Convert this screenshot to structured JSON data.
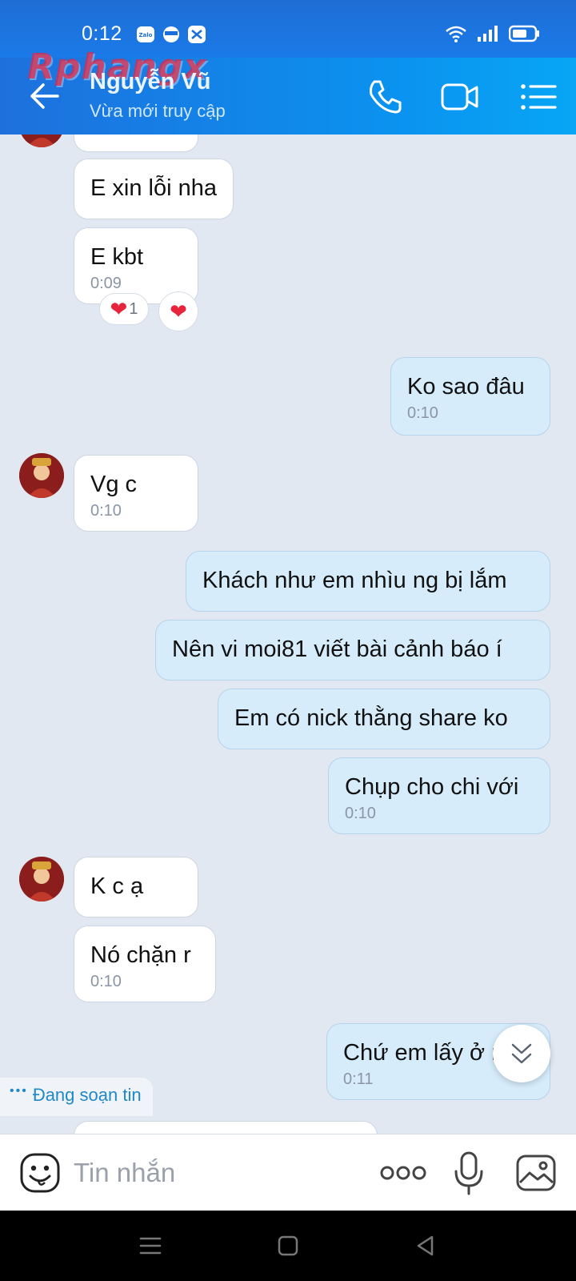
{
  "status_bar": {
    "time": "0:12"
  },
  "header": {
    "watermark": "Rphangx",
    "contact_name": "Nguyễn Vũ",
    "contact_status": "Vừa mới truy cập"
  },
  "messages": [
    {
      "id": "m0",
      "side": "in",
      "text": ""
    },
    {
      "id": "m1",
      "side": "in",
      "text": "E xin lỗi nha"
    },
    {
      "id": "m2",
      "side": "in",
      "text": "E kbt",
      "time": "0:09",
      "reaction_count": "1"
    },
    {
      "id": "m3",
      "side": "out",
      "text": "Ko sao đâu",
      "time": "0:10"
    },
    {
      "id": "m4",
      "side": "in",
      "text": "Vg c",
      "time": "0:10"
    },
    {
      "id": "m5",
      "side": "out",
      "text": "Khách như em nhìu ng bị lắm"
    },
    {
      "id": "m6",
      "side": "out",
      "text": "Nên vi moi81 viết bài cảnh báo í"
    },
    {
      "id": "m7",
      "side": "out",
      "text": "Em có nick thằng share ko"
    },
    {
      "id": "m8",
      "side": "out",
      "text": "Chụp cho chi với",
      "time": "0:10"
    },
    {
      "id": "m9",
      "side": "in",
      "text": "K c ạ"
    },
    {
      "id": "m10",
      "side": "in",
      "text": "Nó chặn r",
      "time": "0:10"
    },
    {
      "id": "m11",
      "side": "out",
      "text": "Chứ em lấy ở nê",
      "time": "0:11"
    }
  ],
  "typing_indicator": "Đang soạn tin",
  "input": {
    "placeholder": "Tin nhắn"
  },
  "colors": {
    "header_start": "#1e70dd",
    "header_end": "#08a6f5",
    "chat_bg": "#e2e8f1",
    "bubble_in": "#ffffff",
    "bubble_out": "#d6ecfb",
    "heart": "#e6243c",
    "typing_text": "#1f88c8"
  },
  "icons": {
    "back": "arrow-left-icon",
    "call": "phone-icon",
    "video": "video-camera-icon",
    "menu": "list-menu-icon",
    "emoji": "smiley-sticker-icon",
    "more": "more-dots-icon",
    "mic": "microphone-icon",
    "image": "image-gallery-icon",
    "scroll": "double-chevron-down-icon"
  }
}
